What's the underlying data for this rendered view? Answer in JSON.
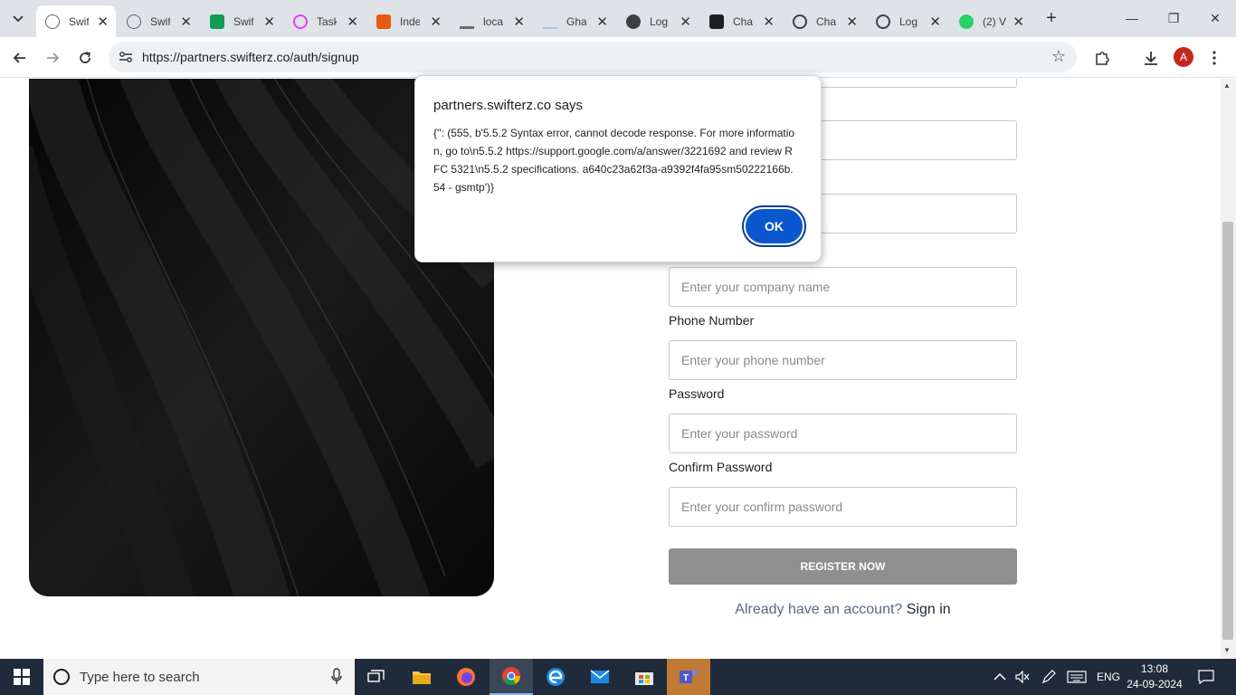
{
  "browser": {
    "tabs": [
      {
        "title": "Swif",
        "active": true,
        "color": "#5f6368"
      },
      {
        "title": "Swif",
        "active": false,
        "color": "#5f6368"
      },
      {
        "title": "Swif",
        "active": false,
        "color": "#0f9d58"
      },
      {
        "title": "Task",
        "active": false,
        "color": "#e040fb"
      },
      {
        "title": "Inde",
        "active": false,
        "color": "#e8590c"
      },
      {
        "title": "loca",
        "active": false,
        "color": "#6b6b6b"
      },
      {
        "title": "Gha",
        "active": false,
        "color": "#9ec9f0"
      },
      {
        "title": "Log",
        "active": false,
        "color": "#3c4043"
      },
      {
        "title": "Cha",
        "active": false,
        "color": "#1f1f1f"
      },
      {
        "title": "Cha",
        "active": false,
        "color": "#3c4043"
      },
      {
        "title": "Log",
        "active": false,
        "color": "#3c4043"
      },
      {
        "title": "(2) V",
        "active": false,
        "color": "#25d366"
      }
    ],
    "url": "https://partners.swifterz.co/auth/signup",
    "profile_initial": "A"
  },
  "form": {
    "fields": [
      {
        "label": "Phone Number",
        "placeholder": "Enter your phone number"
      },
      {
        "label": "Password",
        "placeholder": "Enter your password"
      },
      {
        "label": "Confirm Password",
        "placeholder": "Enter your confirm password"
      }
    ],
    "company_placeholder": "Enter your company name",
    "register_label": "REGISTER NOW",
    "signin_question": "Already have an account?",
    "signin_link": "Sign in"
  },
  "dialog": {
    "title": "partners.swifterz.co says",
    "message": "{'': (555, b'5.5.2 Syntax error, cannot decode response. For more information, go to\\n5.5.2  https://support.google.com/a/answer/3221692 and review RFC 5321\\n5.5.2 specifications. a640c23a62f3a-a9392f4fa95sm50222166b.54 - gsmtp')}",
    "ok_label": "OK"
  },
  "taskbar": {
    "search_placeholder": "Type here to search",
    "language": "ENG",
    "time": "13:08",
    "date": "24-09-2024"
  }
}
